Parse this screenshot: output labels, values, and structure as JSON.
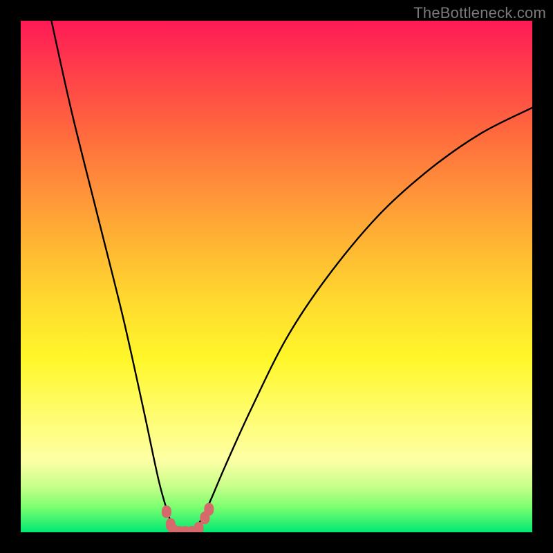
{
  "watermark": "TheBottleneck.com",
  "chart_data": {
    "type": "line",
    "title": "",
    "xlabel": "",
    "ylabel": "",
    "xlim": [
      0,
      100
    ],
    "ylim": [
      0,
      100
    ],
    "series": [
      {
        "name": "bottleneck-curve",
        "x": [
          6,
          10,
          15,
          20,
          24,
          27,
          29,
          30,
          31,
          33,
          35,
          37,
          40,
          45,
          52,
          60,
          70,
          80,
          90,
          100
        ],
        "y": [
          100,
          82,
          62,
          42,
          24,
          10,
          3,
          0,
          0,
          0,
          2,
          6,
          13,
          24,
          38,
          50,
          62,
          71,
          78,
          83
        ]
      }
    ],
    "markers": {
      "name": "highlight-points",
      "color": "#d66a6a",
      "points": [
        {
          "x": 28.5,
          "y": 4
        },
        {
          "x": 29.3,
          "y": 1.5
        },
        {
          "x": 29.8,
          "y": 0.4
        },
        {
          "x": 31.0,
          "y": 0
        },
        {
          "x": 32.2,
          "y": 0
        },
        {
          "x": 33.5,
          "y": 0
        },
        {
          "x": 34.8,
          "y": 0.8
        },
        {
          "x": 36.0,
          "y": 2.8
        },
        {
          "x": 36.8,
          "y": 4.5
        }
      ]
    },
    "gradient_bands": [
      {
        "color": "#ff1a56",
        "stop": 0
      },
      {
        "color": "#ffda2f",
        "stop": 55
      },
      {
        "color": "#00e971",
        "stop": 100
      }
    ]
  }
}
